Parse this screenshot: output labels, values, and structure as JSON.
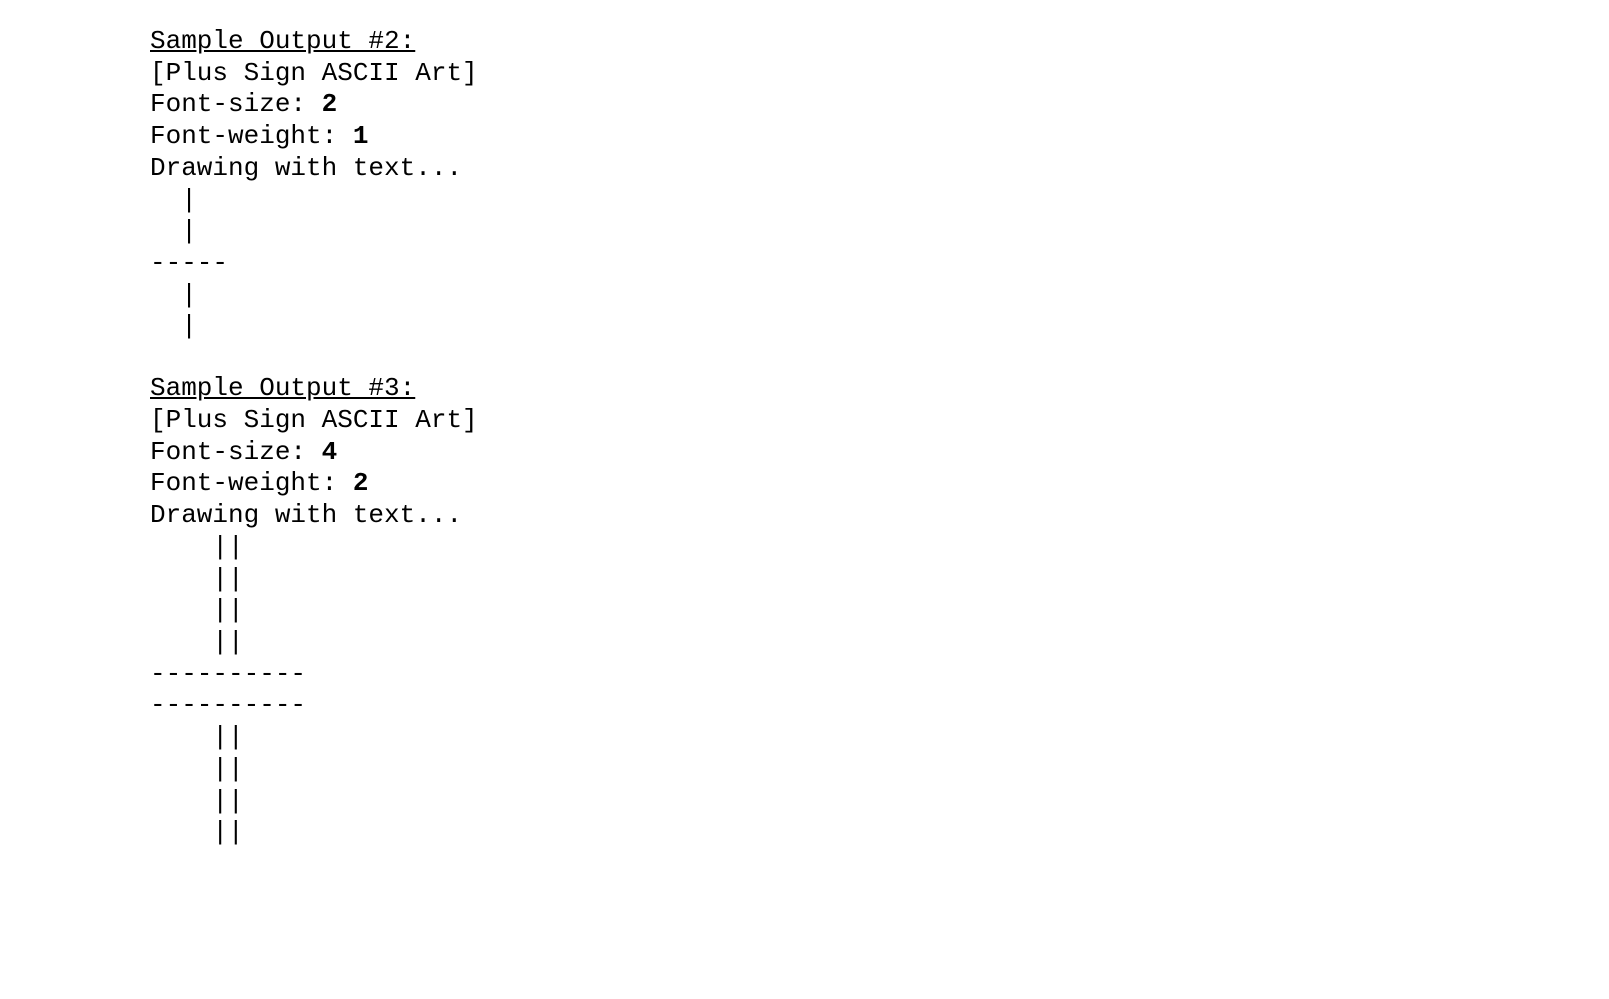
{
  "sample2": {
    "heading": "Sample Output #2:",
    "title": "[Plus Sign ASCII Art]",
    "font_size_label": "Font-size: ",
    "font_size_value": "2",
    "font_weight_label": "Font-weight: ",
    "font_weight_value": "1",
    "drawing_label": "Drawing with text...",
    "art": "  |\n  |\n-----\n  |\n  |"
  },
  "sample3": {
    "heading": "Sample Output #3:",
    "title": "[Plus Sign ASCII Art]",
    "font_size_label": "Font-size: ",
    "font_size_value": "4",
    "font_weight_label": "Font-weight: ",
    "font_weight_value": "2",
    "drawing_label": "Drawing with text...",
    "art": "    ||\n    ||\n    ||\n    ||\n----------\n----------\n    ||\n    ||\n    ||\n    ||"
  }
}
